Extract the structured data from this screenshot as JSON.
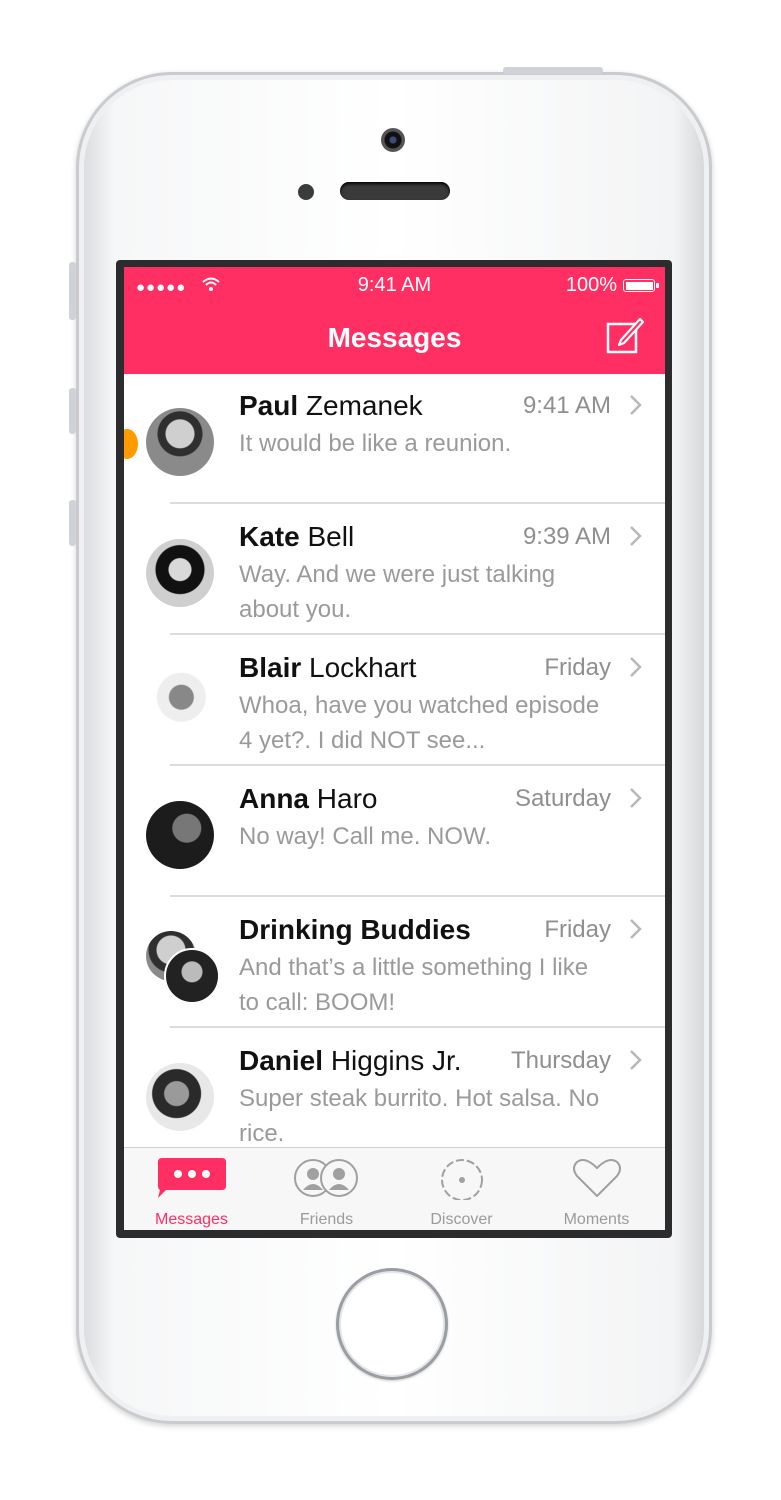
{
  "status": {
    "signal": "●●●●●",
    "time": "9:41 AM",
    "battery": "100%"
  },
  "nav": {
    "title": "Messages",
    "compose_icon": "compose-icon"
  },
  "messages": [
    {
      "first": "Paul",
      "last": "Zemanek",
      "time": "9:41 AM",
      "preview": "It would be like a reunion.",
      "unread": true
    },
    {
      "first": "Kate",
      "last": "Bell",
      "time": "9:39 AM",
      "preview": "Way. And we were just talking about you.",
      "unread": false
    },
    {
      "first": "Blair",
      "last": "Lockhart",
      "time": "Friday",
      "preview": "Whoa, have you watched episode 4 yet?. I did NOT see...",
      "unread": false
    },
    {
      "first": "Anna",
      "last": "Haro",
      "time": "Saturday",
      "preview": "No way! Call me. NOW.",
      "unread": false
    },
    {
      "first": "Drinking Buddies",
      "last": "",
      "time": "Friday",
      "preview": "And that’s a little something I like to call: BOOM!",
      "unread": false
    },
    {
      "first": "Daniel",
      "last": "Higgins Jr.",
      "time": "Thursday",
      "preview": "Super steak burrito. Hot salsa. No rice.",
      "unread": false
    }
  ],
  "tabs": [
    {
      "label": "Messages",
      "icon": "chat-bubble-icon",
      "active": true
    },
    {
      "label": "Friends",
      "icon": "friends-icon",
      "active": false
    },
    {
      "label": "Discover",
      "icon": "discover-icon",
      "active": false
    },
    {
      "label": "Moments",
      "icon": "heart-icon",
      "active": false
    }
  ],
  "colors": {
    "accent": "#ff2e63",
    "unread": "#ff9a00",
    "muted": "#9a9a9a"
  }
}
